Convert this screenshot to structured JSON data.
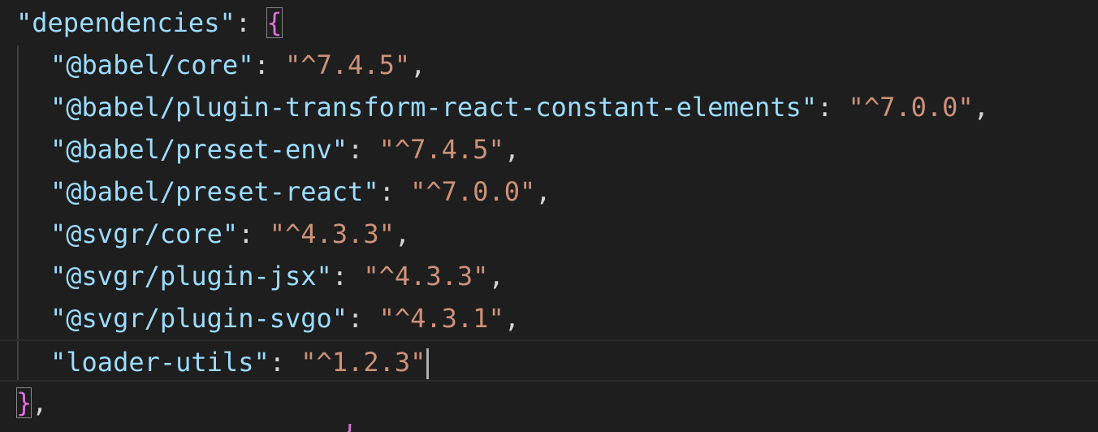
{
  "editor": {
    "lines": [
      {
        "key": "\"dependencies\"",
        "colon": ": ",
        "brace_open": "{"
      },
      {
        "key": "\"@babel/core\"",
        "colon": ": ",
        "value": "\"^7.4.5\"",
        "comma": ","
      },
      {
        "key": "\"@babel/plugin-transform-react-constant-elements\"",
        "colon": ": ",
        "value": "\"^7.0.0\"",
        "comma": ","
      },
      {
        "key": "\"@babel/preset-env\"",
        "colon": ": ",
        "value": "\"^7.4.5\"",
        "comma": ","
      },
      {
        "key": "\"@babel/preset-react\"",
        "colon": ": ",
        "value": "\"^7.0.0\"",
        "comma": ","
      },
      {
        "key": "\"@svgr/core\"",
        "colon": ": ",
        "value": "\"^4.3.3\"",
        "comma": ","
      },
      {
        "key": "\"@svgr/plugin-jsx\"",
        "colon": ": ",
        "value": "\"^4.3.3\"",
        "comma": ","
      },
      {
        "key": "\"@svgr/plugin-svgo\"",
        "colon": ": ",
        "value": "\"^4.3.1\"",
        "comma": ","
      },
      {
        "key": "\"loader-utils\"",
        "colon": ": ",
        "value": "\"^1.2.3\""
      },
      {
        "brace_close": "}",
        "comma": ","
      }
    ],
    "partial_next_line": "{"
  },
  "colors": {
    "background": "#1e1e1e",
    "key": "#9cdcfe",
    "string": "#ce9178",
    "punctuation": "#d4d4d4",
    "brace": "#da70d6"
  }
}
